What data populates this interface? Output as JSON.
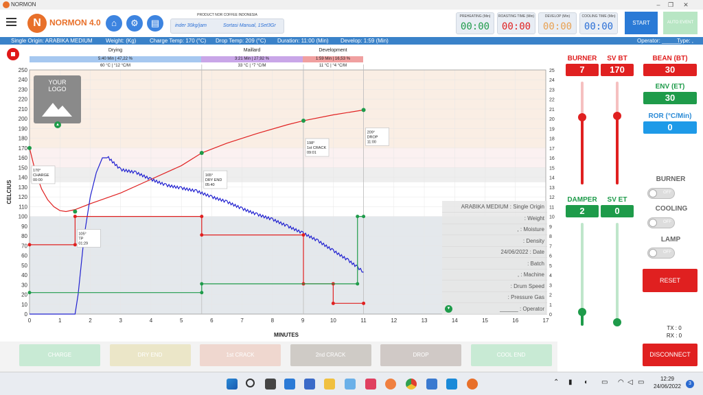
{
  "window": {
    "title": "NORMON"
  },
  "header": {
    "brand": "NORMON 4.0",
    "product_label": "PRODUCT NOR COFFEE INDONESIA",
    "product_capacity": "inder 30kg/jam",
    "product_sort": "Sortasi Manual, 1Set3Gr",
    "timers": [
      {
        "label": "PREHEATING (Min)",
        "value": "00:00",
        "color": "#1e9b4a"
      },
      {
        "label": "ROASTING TIME (Min)",
        "value": "00:00",
        "color": "#e02020"
      },
      {
        "label": "DEVELOP (Min)",
        "value": "00:00",
        "color": "#e8a050"
      },
      {
        "label": "COOLING TIME (Min)",
        "value": "00:00",
        "color": "#2a6fd6"
      }
    ],
    "start_label": "START",
    "auto_event_label": "AUTO EVENT"
  },
  "infobar": {
    "origin": "Single Origin: ARABIKA MEDIUM",
    "weight": "Weight:  (Kg)",
    "charge": "Charge Temp: 170 (°C)",
    "drop": "Drop Temp: 209 (°C)",
    "duration": "Duration: 11:00 (Min)",
    "develop": "Develop: 1:59 (Min)",
    "operator": "Operator: ______",
    "type": "Type: ,"
  },
  "phases": [
    {
      "name": "Drying",
      "time": "5:40 Min | 47,22 %",
      "temp": "60 °C | °12 °C/M",
      "color": "#a6c8f0"
    },
    {
      "name": "Maillard",
      "time": "3:21 Min | 27,92 %",
      "temp": "33 °C | °7 °C/M",
      "color": "#c9a6e8"
    },
    {
      "name": "Development",
      "time": "1:59 Min | 16,53 %",
      "temp": "11 °C | °4 °C/M",
      "color": "#f0a0a0"
    }
  ],
  "logo": {
    "line1": "YOUR",
    "line2": "LOGO"
  },
  "chart_data": {
    "type": "line",
    "xlabel": "MINUTES",
    "ylabel": "CELCIUS",
    "y2label": "ROR (°C/Min)",
    "xlim": [
      0,
      17
    ],
    "ylim": [
      0,
      250
    ],
    "y2lim": [
      0,
      25
    ],
    "x_ticks": [
      0,
      1,
      2,
      3,
      4,
      5,
      6,
      7,
      8,
      9,
      10,
      11,
      12,
      13,
      14,
      15,
      16,
      17
    ],
    "y_ticks": [
      0,
      10,
      20,
      30,
      40,
      50,
      60,
      70,
      80,
      90,
      100,
      110,
      120,
      130,
      140,
      150,
      160,
      170,
      180,
      190,
      200,
      210,
      220,
      230,
      240,
      250
    ],
    "y2_ticks": [
      0,
      1,
      2,
      3,
      4,
      5,
      6,
      7,
      8,
      9,
      10,
      11,
      12,
      13,
      14,
      15,
      16,
      17,
      18,
      19,
      20,
      21,
      22,
      23,
      24,
      25
    ],
    "series": [
      {
        "color": "#e02020",
        "points": [
          [
            0,
            170
          ],
          [
            0.2,
            145
          ],
          [
            0.4,
            128
          ],
          [
            0.6,
            117
          ],
          [
            0.8,
            110
          ],
          [
            1.0,
            106
          ],
          [
            1.2,
            105
          ],
          [
            1.5,
            107
          ],
          [
            2,
            113
          ],
          [
            3,
            124
          ],
          [
            4,
            138
          ],
          [
            5,
            152
          ],
          [
            5.67,
            165
          ],
          [
            6.5,
            175
          ],
          [
            7.5,
            185
          ],
          [
            8.5,
            194
          ],
          [
            9.02,
            198
          ],
          [
            10,
            204
          ],
          [
            11,
            209
          ]
        ]
      },
      {
        "color": "#2020d0",
        "points": [
          [
            0,
            0
          ],
          [
            1.5,
            -2
          ],
          [
            1.6,
            2
          ],
          [
            1.8,
            8
          ],
          [
            2.0,
            12
          ],
          [
            2.2,
            14.5
          ],
          [
            2.4,
            16
          ],
          [
            2.6,
            16
          ],
          [
            3,
            14.8
          ],
          [
            3.5,
            14.5
          ],
          [
            4,
            13.8
          ],
          [
            4.5,
            13.2
          ],
          [
            5,
            12.9
          ],
          [
            5.5,
            12.6
          ],
          [
            6,
            12
          ],
          [
            6.5,
            11.5
          ],
          [
            7,
            10.8
          ],
          [
            7.5,
            10.2
          ],
          [
            8,
            9.7
          ],
          [
            8.5,
            9.0
          ],
          [
            9,
            8.3
          ],
          [
            9.5,
            7.5
          ],
          [
            10,
            6.5
          ],
          [
            10.5,
            5.5
          ],
          [
            10.8,
            4.8
          ],
          [
            11,
            4.3
          ]
        ]
      },
      {
        "color": "#e02020",
        "points": [
          [
            0,
            71
          ],
          [
            1.5,
            71
          ],
          [
            1.5,
            100
          ],
          [
            5.67,
            100
          ],
          [
            5.67,
            81
          ],
          [
            9.02,
            81
          ],
          [
            9.02,
            31
          ],
          [
            10,
            31
          ],
          [
            10,
            11
          ],
          [
            11,
            11
          ]
        ]
      },
      {
        "color": "#1e9b4a",
        "points": [
          [
            0,
            22
          ],
          [
            5.67,
            22
          ],
          [
            5.67,
            31
          ],
          [
            10.8,
            31
          ],
          [
            10.8,
            100
          ],
          [
            11,
            100
          ]
        ]
      }
    ],
    "events": [
      {
        "label1": "170°",
        "label2": "CHARGE",
        "label3": "00:00",
        "x": 0,
        "y": 170
      },
      {
        "label1": "105°",
        "label2": "TP",
        "label3": "01:29",
        "x": 1.5,
        "y": 105
      },
      {
        "label1": "165°",
        "label2": "DRY END",
        "label3": "05:40",
        "x": 5.67,
        "y": 165
      },
      {
        "label1": "198°",
        "label2": "1st CRACK",
        "label3": "09:01",
        "x": 9.02,
        "y": 198
      },
      {
        "label1": "209°",
        "label2": "DROP",
        "label3": "11:00",
        "x": 11,
        "y": 209
      }
    ]
  },
  "info_panel": [
    {
      "value": "ARABIKA MEDIUM",
      "key": ": Single Origin"
    },
    {
      "value": "",
      "key": ": Weight"
    },
    {
      "value": ",",
      "key": ": Moisture"
    },
    {
      "value": "",
      "key": ": Density"
    },
    {
      "value": "24/06/2022",
      "key": ": Date"
    },
    {
      "value": "",
      "key": ": Batch"
    },
    {
      "value": ",",
      "key": ": Machine"
    },
    {
      "value": "",
      "key": ": Drum Speed"
    },
    {
      "value": "",
      "key": ": Pressure Gas"
    },
    {
      "value": "______",
      "key": ": Operator"
    }
  ],
  "controls": {
    "burner_label": "BURNER",
    "burner_val": "7",
    "svbt_label": "SV BT",
    "svbt_val": "170",
    "damper_label": "DAMPER",
    "damper_val": "2",
    "svet_label": "SV ET",
    "svet_val": "0",
    "bean_label": "BEAN (BT)",
    "bean_val": "30",
    "env_label": "ENV (ET)",
    "env_val": "30",
    "ror_label": "ROR (°C/Min)",
    "ror_val": "0",
    "toggle_burner": "BURNER",
    "toggle_cooling": "COOLING",
    "toggle_lamp": "LAMP",
    "off": "OFF",
    "reset": "RESET",
    "tx": "TX : 0",
    "rx": "RX : 0",
    "disconnect": "DISCONNECT"
  },
  "events_buttons": [
    "CHARGE",
    "DRY END",
    "1st CRACK",
    "2nd CRACK",
    "DROP",
    "COOL END"
  ],
  "taskbar": {
    "time": "12:29",
    "date": "24/06/2022",
    "badge": "3"
  }
}
